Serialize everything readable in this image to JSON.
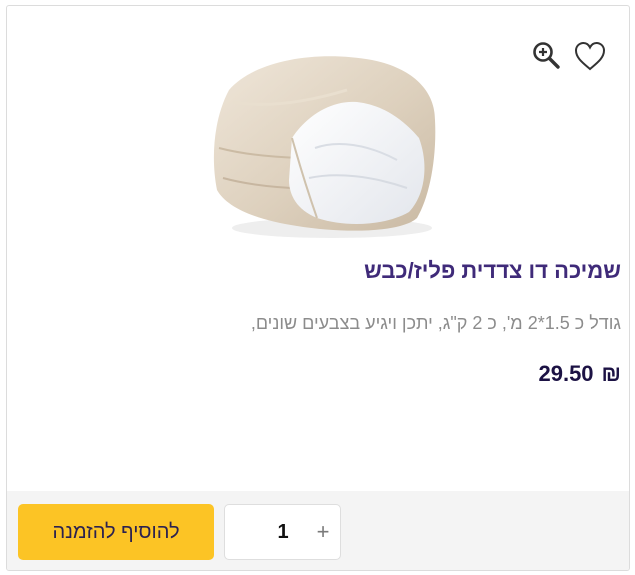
{
  "product": {
    "title": "שמיכה דו צדדית פליז/כבש",
    "description": "גודל כ 1.5*2 מ', כ 2 ק\"ג, יתכן ויגיע בצבעים שונים,",
    "price": "29.50",
    "currency_symbol": "₪"
  },
  "actions": {
    "add_to_order_label": "להוסיף להזמנה",
    "quantity": "1",
    "plus_label": "+"
  },
  "icons": {
    "zoom": "zoom-in-icon",
    "wishlist": "heart-icon"
  },
  "colors": {
    "title": "#3f2a79",
    "price": "#1c1244",
    "add_button": "#fcc425",
    "footer_bg": "#f4f4f4"
  }
}
